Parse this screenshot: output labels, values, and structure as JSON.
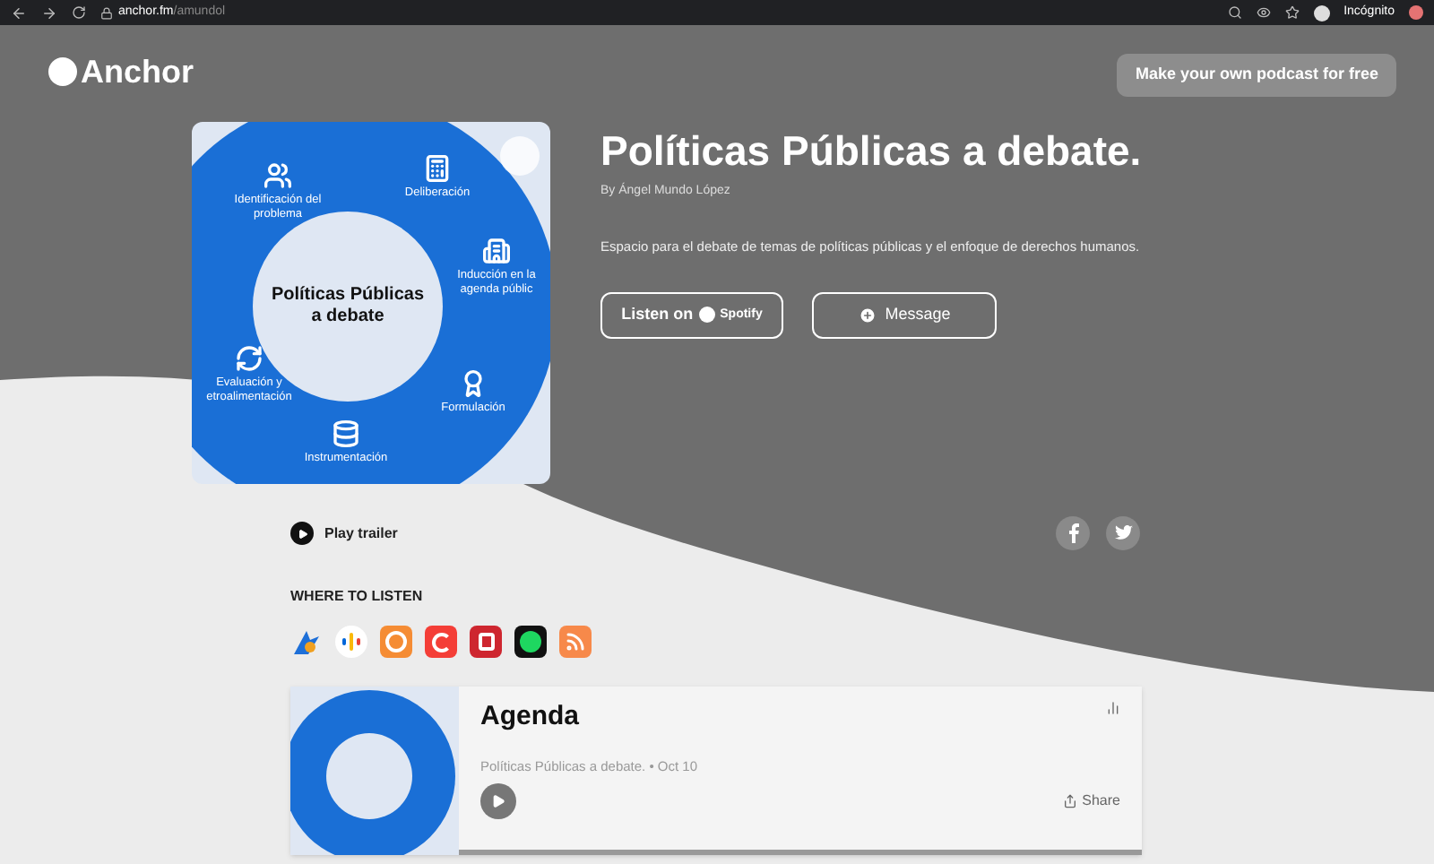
{
  "browser": {
    "url_host": "anchor.fm",
    "url_path": "/amundol",
    "profile": "Incógnito"
  },
  "header": {
    "logo": "Anchor",
    "cta": "Make your own podcast for free"
  },
  "podcast": {
    "title": "Políticas Públicas a debate.",
    "author": "By Ángel Mundo López",
    "description": "Espacio para el debate de temas de políticas públicas y el enfoque de derechos humanos.",
    "cover": {
      "center": "Políticas Públicas a debate",
      "labels": [
        {
          "kind": "people",
          "text": "Identificación del problema"
        },
        {
          "kind": "calculator",
          "text": "Deliberación"
        },
        {
          "kind": "building",
          "text": "Inducción en la agenda públic"
        },
        {
          "kind": "cycle",
          "text": "Evaluación y etroalimentación"
        },
        {
          "kind": "database",
          "text": "Instrumentación"
        },
        {
          "kind": "award",
          "text": "Formulación"
        }
      ]
    },
    "buttons": [
      {
        "kind": "spotify",
        "label": "Listen on",
        "brand": "Spotify"
      },
      {
        "kind": "message",
        "label": "Message"
      }
    ]
  },
  "trailer": {
    "label": "Play trailer"
  },
  "social": [
    {
      "kind": "facebook"
    },
    {
      "kind": "twitter"
    }
  ],
  "where_to_listen": {
    "heading": "WHERE TO LISTEN",
    "platforms": [
      {
        "kind": "breaker"
      },
      {
        "kind": "google"
      },
      {
        "kind": "overcast"
      },
      {
        "kind": "pocketcasts"
      },
      {
        "kind": "radiopublic"
      },
      {
        "kind": "spotify"
      },
      {
        "kind": "rss"
      }
    ]
  },
  "episode": {
    "title": "Agenda",
    "meta": "Políticas Públicas a debate. • Oct 10",
    "share": "Share"
  }
}
